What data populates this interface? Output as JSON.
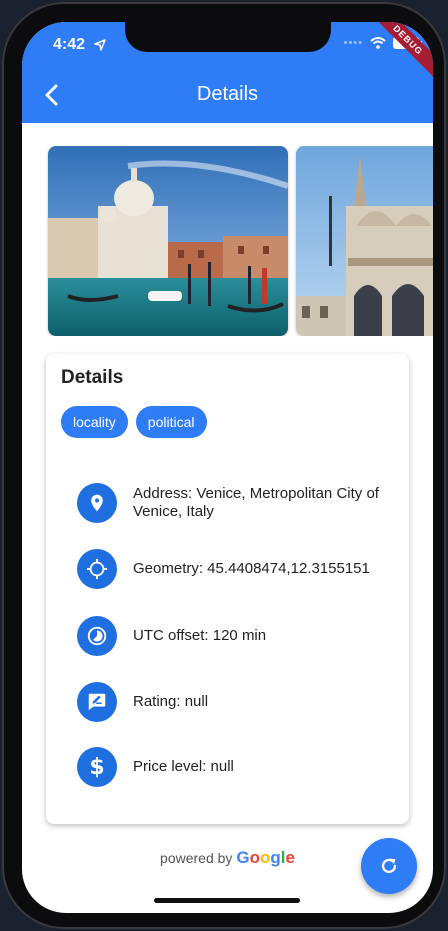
{
  "status_bar": {
    "time": "4:42"
  },
  "debug_banner": "DEBUG",
  "app_bar": {
    "title": "Details"
  },
  "details": {
    "heading": "Details",
    "chips": [
      "locality",
      "political"
    ],
    "rows": [
      {
        "icon": "location-pin-icon",
        "text": "Address: Venice, Metropolitan City of Venice, Italy"
      },
      {
        "icon": "crosshair-icon",
        "text": "Geometry: 45.4408474,12.3155151"
      },
      {
        "icon": "clock-icon",
        "text": "UTC offset: 120 min"
      },
      {
        "icon": "rate-review-icon",
        "text": "Rating: null"
      },
      {
        "icon": "dollar-icon",
        "text": "Price level: null"
      }
    ]
  },
  "footer": {
    "powered_by": "powered by",
    "google": [
      "G",
      "o",
      "o",
      "g",
      "l",
      "e"
    ],
    "google_colors": [
      "#4285F4",
      "#EA4335",
      "#FBBC05",
      "#4285F4",
      "#34A853",
      "#EA4335"
    ]
  },
  "colors": {
    "accent": "#2e7cf6",
    "icon_circle": "#1f6fe0"
  }
}
